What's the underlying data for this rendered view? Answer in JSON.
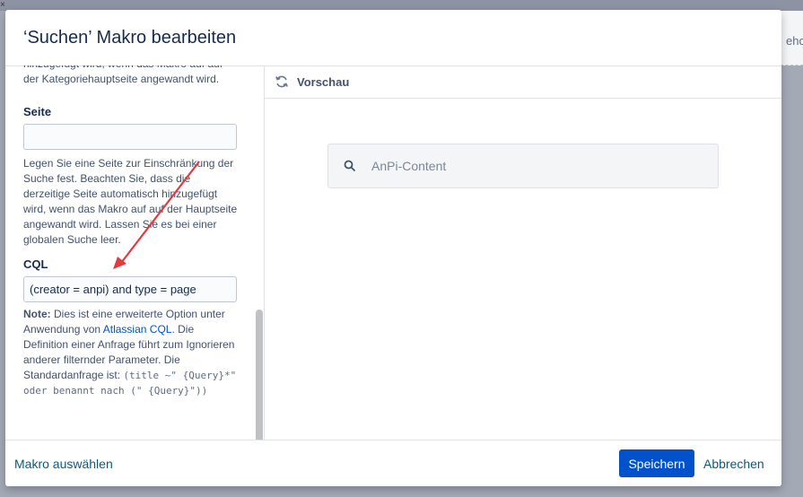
{
  "background": {
    "right_text": "eho"
  },
  "dialog": {
    "title": "‘Suchen’ Makro bearbeiten"
  },
  "left": {
    "top_help": "hinzugefügt wird, wenn das Makro auf auf der Kategoriehauptseite angewandt wird.",
    "seite_label": "Seite",
    "seite_value": "",
    "seite_help": "Legen Sie eine Seite zur Einschränkung der Suche fest. Beachten Sie, dass die derzeitige Seite automatisch hinzugefügt wird, wenn das Makro auf auf der Hauptseite angewandt wird. Lassen Sie es bei einer globalen Suche leer.",
    "cql_label": "CQL",
    "cql_value": "(creator = anpi) and type = page",
    "note_bold": "Note:",
    "note_text1": " Dies ist eine erweiterte Option unter Anwendung von ",
    "note_link": "Atlassian CQL",
    "note_text2": ". Die Definition einer Anfrage führt zum Ignorieren anderer filternder Parameter. Die Standardanfrage ist: ",
    "note_code": "(title ~\" {Query}*\" oder benannt nach (\" {Query}\"))"
  },
  "preview": {
    "title": "Vorschau",
    "search_value": "AnPi-Content"
  },
  "footer": {
    "select_macro": "Makro auswählen",
    "save": "Speichern",
    "cancel": "Abbrechen"
  },
  "colors": {
    "primary": "#0052cc",
    "arrow": "#e5393e"
  }
}
